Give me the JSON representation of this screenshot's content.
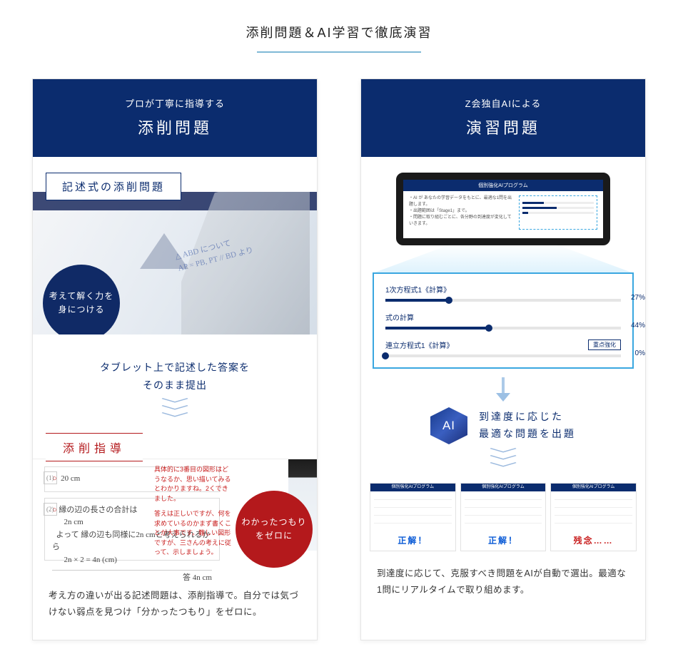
{
  "page": {
    "title": "添削問題＆AI学習で徹底演習"
  },
  "left": {
    "header_sub": "プロが丁寧に指導する",
    "header_main": "添削問題",
    "tag": "記述式の添削問題",
    "badge_navy": "考えて解く力を\n身につける",
    "handwriting_lines": "△ ABD について\nAP = PB, PT // BD より",
    "blue_text_1": "タブレット上で記述した答案を",
    "blue_text_2": "そのまま提出",
    "correction_title": "添削指導",
    "answer1": "20 cm",
    "answer2_label": "縁の辺の長さの合計は",
    "answer2_line1": "2n cm",
    "answer2_line2": "よって 縁の辺も同様に2n cmと考えられるから",
    "answer2_line3": "2n × 2 = 4n (cm)",
    "answer2_final": "答  4n cm",
    "red_notes_1": "具体的に3番目の図形はどうなるか、思い描いてみるとわかりますね。2くできました。",
    "red_notes_2": "答えは正しいですが、何を求めているのかまず書くことが大事です。難しい図形ですが、三さんの考えに従って、示しましょう。",
    "badge_red": "わかったつもり\nをゼロに",
    "desc": "考え方の違いが出る記述問題は、添削指導で。自分では気づけない弱点を見つけ「分かったつもり」をゼロに。"
  },
  "right": {
    "header_sub": "Z会独自AIによる",
    "header_main": "演習問題",
    "tablet_title": "個別強化AIプログラム",
    "tablet_body": "・AI が あなたの学習データをもとに、最適な1問を出題します。\n・出題範囲は「Stage1」まで。\n・問題に取り組むごとに、各分野の到達度が変化していきます。",
    "progress": [
      {
        "label": "1次方程式1《計算》",
        "value": 27
      },
      {
        "label": "式の計算",
        "value": 44
      },
      {
        "label": "連立方程式1《計算》",
        "value": 0,
        "badge": "重点強化"
      }
    ],
    "ai_badge": "AI",
    "ai_text_1": "到達度に応じた",
    "ai_text_2": "最適な問題を出題",
    "thumbs_head": "個別強化AIプログラム",
    "thumb_results": [
      "正解！",
      "正解！",
      "残念……"
    ],
    "desc": "到達度に応じて、克服すべき問題をAIが自動で選出。最適な1問にリアルタイムで取り組めます。"
  }
}
